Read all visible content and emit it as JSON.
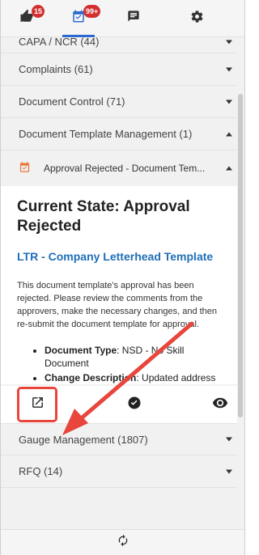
{
  "tabs": [
    {
      "icon": "thumbs-up-icon",
      "badge": "15",
      "active": false
    },
    {
      "icon": "calendar-check-icon",
      "badge": "99+",
      "active": true
    },
    {
      "icon": "message-icon",
      "badge": null,
      "active": false
    },
    {
      "icon": "gear-icon",
      "badge": null,
      "active": false
    }
  ],
  "categories_top": [
    {
      "label": "CAPA / NCR (44)"
    },
    {
      "label": "Complaints (61)"
    },
    {
      "label": "Document Control (71)"
    },
    {
      "label": "Document Template Management (1)"
    }
  ],
  "item": {
    "label": "Approval Rejected - Document Tem...",
    "state_title": "Current State: Approval Rejected",
    "doc_link": "LTR - Company Letterhead Template",
    "description": "This document template's approval has been rejected. Please review the comments from the approvers, make the necessary changes, and then re-submit the document template for approval.",
    "fields": [
      {
        "label": "Document Type",
        "value": ": NSD - No Skill Document"
      },
      {
        "label": "Change Description",
        "value": ": Updated address"
      }
    ],
    "actions": [
      {
        "icon": "open-external-icon"
      },
      {
        "icon": "check-circle-icon"
      },
      {
        "icon": "eye-icon"
      }
    ]
  },
  "categories_bottom": [
    {
      "label": "Gauge Management (1807)"
    },
    {
      "label": "RFQ (14)"
    }
  ],
  "footer": {
    "icon": "refresh-icon"
  },
  "colors": {
    "accent": "#2a6ad0",
    "badge": "#d32f2f",
    "link": "#1f6fb7",
    "highlight": "#e8453c",
    "calendar": "#e8763c"
  }
}
